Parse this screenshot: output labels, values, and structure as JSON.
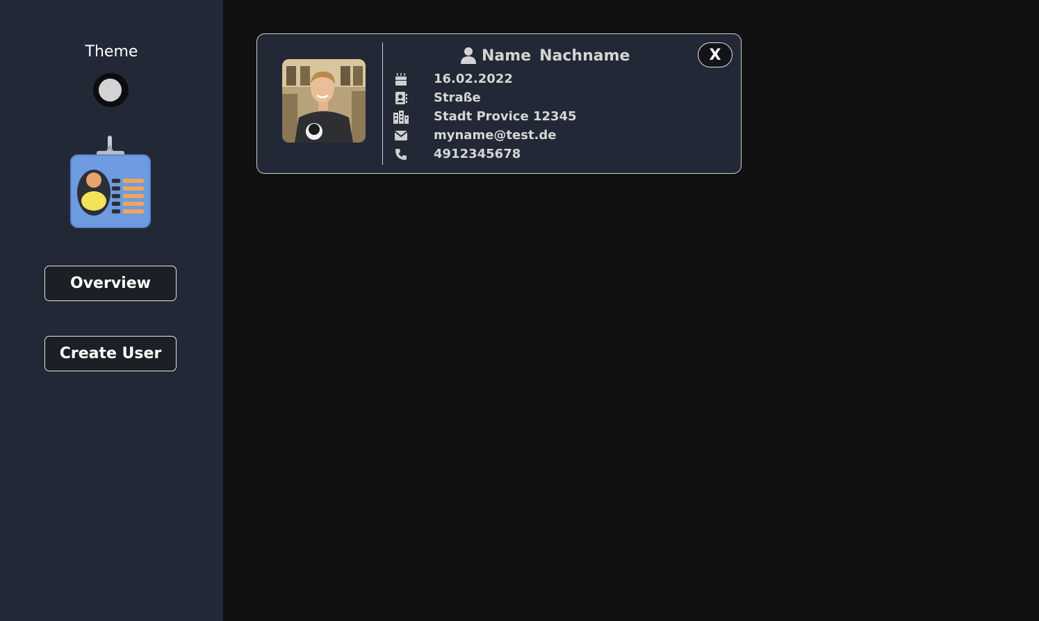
{
  "sidebar": {
    "theme_label": "Theme",
    "logo_icon": "id-badge-icon",
    "nav": [
      {
        "label": "Overview",
        "icon": "none"
      },
      {
        "label": "Create User",
        "icon": "none"
      }
    ]
  },
  "card": {
    "first_name": "Name",
    "last_name": "Nachname",
    "close_label": "X",
    "photo_icon": "profile-photo",
    "rows": [
      {
        "icon": "birthday-cake-icon",
        "value": "16.02.2022"
      },
      {
        "icon": "address-book-icon",
        "value": "Straße"
      },
      {
        "icon": "city-icon",
        "value": "Stadt Provice 12345"
      },
      {
        "icon": "envelope-icon",
        "value": "myname@test.de"
      },
      {
        "icon": "phone-icon",
        "value": "4912345678"
      }
    ]
  },
  "colors": {
    "sidebar_bg": "#222835",
    "main_bg": "#111112",
    "card_bg": "#222835",
    "text_muted": "#d6d6d6"
  }
}
